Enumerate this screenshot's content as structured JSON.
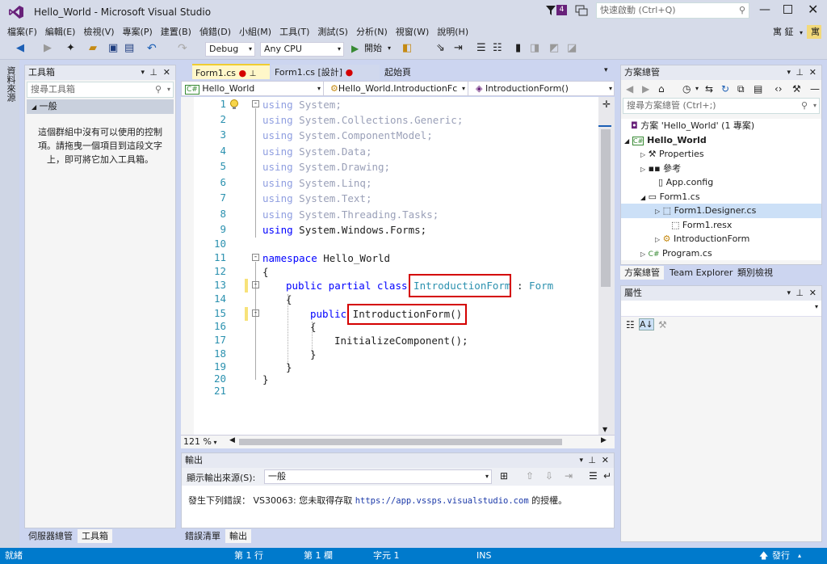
{
  "window": {
    "title": "Hello_World - Microsoft Visual Studio",
    "notification_count": "4",
    "quick_launch_placeholder": "快速啟動 (Ctrl+Q)",
    "user_name": "寓 鉦",
    "user_avatar_initial": "寓"
  },
  "menu": [
    "檔案(F)",
    "編輯(E)",
    "檢視(V)",
    "專案(P)",
    "建置(B)",
    "偵錯(D)",
    "小組(M)",
    "工具(T)",
    "測試(S)",
    "分析(N)",
    "視窗(W)",
    "說明(H)"
  ],
  "toolbar": {
    "config": "Debug",
    "platform": "Any CPU",
    "start_label": "開始"
  },
  "left_strip_label": "資料來源",
  "toolbox": {
    "title": "工具箱",
    "search_placeholder": "搜尋工具箱",
    "group": "一般",
    "empty_message": "這個群組中沒有可以使用的控制項。請拖曳一個項目到這段文字上，即可將它加入工具箱。",
    "bottom_tabs": [
      "伺服器總管",
      "工具箱"
    ]
  },
  "editor": {
    "tabs": [
      {
        "label": "Form1.cs"
      },
      {
        "label": "Form1.cs [設計]"
      },
      {
        "label": "起始頁"
      }
    ],
    "nav": {
      "project": "Hello_World",
      "class": "Hello_World.IntroductionFc",
      "member": "IntroductionForm()"
    },
    "line_numbers": [
      "1",
      "2",
      "3",
      "4",
      "5",
      "6",
      "7",
      "8",
      "9",
      "10",
      "11",
      "12",
      "13",
      "14",
      "15",
      "16",
      "17",
      "18",
      "19",
      "20",
      "21"
    ],
    "lines": [
      {
        "kw": "using",
        "rest": " System;"
      },
      {
        "kw": "using",
        "rest": " System.Collections.Generic;"
      },
      {
        "kw": "using",
        "rest": " System.ComponentModel;"
      },
      {
        "kw": "using",
        "rest": " System.Data;"
      },
      {
        "kw": "using",
        "rest": " System.Drawing;"
      },
      {
        "kw": "using",
        "rest": " System.Linq;"
      },
      {
        "kw": "using",
        "rest": " System.Text;"
      },
      {
        "kw": "using",
        "rest": " System.Threading.Tasks;"
      },
      {
        "kw": "using",
        "rest": " System.Windows.Forms;"
      },
      {
        "kw": "",
        "rest": ""
      },
      {
        "kw": "namespace",
        "rest": " Hello_World"
      },
      {
        "kw": "",
        "rest": "{"
      },
      {
        "kw": "public partial class",
        "type": "IntroductionForm",
        "sep": " : ",
        "base": "Form"
      },
      {
        "kw": "",
        "rest": "{"
      },
      {
        "kw": "public",
        "rest": " IntroductionForm()"
      },
      {
        "kw": "",
        "rest": "{"
      },
      {
        "kw": "",
        "rest": "InitializeComponent();"
      },
      {
        "kw": "",
        "rest": "}"
      },
      {
        "kw": "",
        "rest": "}"
      },
      {
        "kw": "",
        "rest": "}"
      },
      {
        "kw": "",
        "rest": ""
      }
    ],
    "zoom": "121 %"
  },
  "output": {
    "title": "輸出",
    "source_label": "顯示輸出來源(S):",
    "source_value": "一般",
    "message": "發生下列錯誤： VS30063: 您未取得存取 ",
    "url": "https://app.vssps.visualstudio.com",
    "message_end": " 的授權。",
    "bottom_tabs": [
      "錯誤清單",
      "輸出"
    ]
  },
  "solution": {
    "title": "方案總管",
    "search_placeholder": "搜尋方案總管 (Ctrl+;)",
    "items": [
      {
        "label": "方案 'Hello_World' (1 專案)",
        "icon": "solution-icon"
      },
      {
        "label": "Hello_World",
        "icon": "csharp-project-icon"
      },
      {
        "label": "Properties",
        "icon": "wrench-icon"
      },
      {
        "label": "參考",
        "icon": "references-icon"
      },
      {
        "label": "App.config",
        "icon": "config-file-icon"
      },
      {
        "label": "Form1.cs",
        "icon": "form-icon"
      },
      {
        "label": "Form1.Designer.cs",
        "icon": "designer-file-icon"
      },
      {
        "label": "Form1.resx",
        "icon": "resx-file-icon"
      },
      {
        "label": "IntroductionForm",
        "icon": "class-icon"
      },
      {
        "label": "Program.cs",
        "icon": "csharp-file-icon"
      }
    ],
    "bottom_tabs": [
      "方案總管",
      "Team Explorer",
      "類別檢視"
    ]
  },
  "properties": {
    "title": "屬性"
  },
  "status": {
    "ready": "就緒",
    "line": "第 1 行",
    "col": "第 1 欄",
    "char": "字元 1",
    "ins": "INS",
    "publish": "發行"
  },
  "colors": {
    "accent": "#007acc",
    "vs_purple": "#68217a",
    "highlight": "#d40000"
  }
}
